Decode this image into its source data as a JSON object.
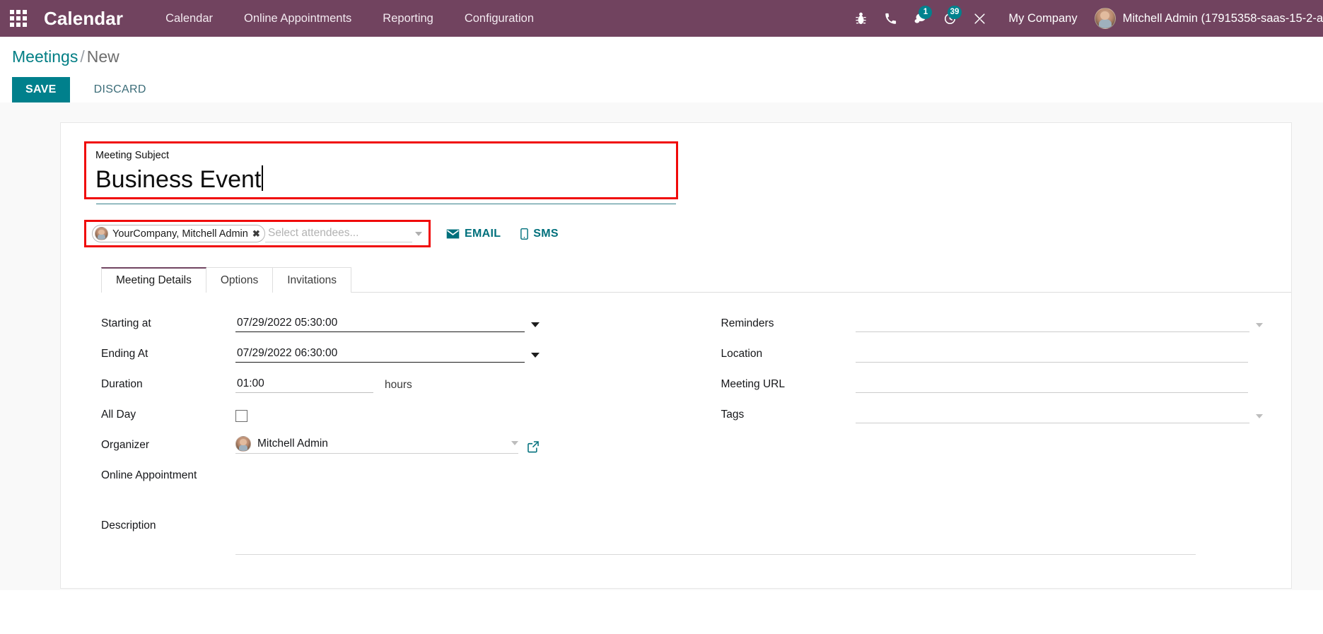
{
  "navbar": {
    "apps_icon": "apps-grid-icon",
    "brand": "Calendar",
    "menu": [
      {
        "label": "Calendar"
      },
      {
        "label": "Online Appointments"
      },
      {
        "label": "Reporting"
      },
      {
        "label": "Configuration"
      }
    ],
    "sys_icons": [
      {
        "name": "bug-icon",
        "badge": ""
      },
      {
        "name": "phone-icon",
        "badge": ""
      },
      {
        "name": "messages-icon",
        "badge": "1"
      },
      {
        "name": "activities-clock-icon",
        "badge": "39"
      },
      {
        "name": "tools-icon",
        "badge": ""
      }
    ],
    "company": "My Company",
    "user": "Mitchell Admin (17915358-saas-15-2-a",
    "bg_color": "#71435f",
    "badge_color": "#00828e"
  },
  "breadcrumb": {
    "root": "Meetings",
    "separator": "/",
    "current": "New"
  },
  "actions": {
    "save_label": "SAVE",
    "discard_label": "DISCARD",
    "save_color": "#00808c"
  },
  "form": {
    "subject": {
      "label": "Meeting Subject",
      "value": "Business Event",
      "highlight_color": "#f00a0a"
    },
    "attendees": {
      "tag": "YourCompany, Mitchell Admin",
      "tag_remove": "✖",
      "placeholder": "Select attendees...",
      "email_button": "EMAIL",
      "sms_button": "SMS"
    },
    "tabs": [
      {
        "label": "Meeting Details",
        "active": true
      },
      {
        "label": "Options",
        "active": false
      },
      {
        "label": "Invitations",
        "active": false
      }
    ],
    "left_fields": [
      {
        "label": "Starting at",
        "value": "07/29/2022 05:30:00"
      },
      {
        "label": "Ending At",
        "value": "07/29/2022 06:30:00"
      },
      {
        "label": "Duration",
        "value": "01:00",
        "units": "hours"
      },
      {
        "label": "All Day",
        "value": ""
      },
      {
        "label": "Organizer",
        "value": "Mitchell Admin"
      },
      {
        "label": "Online Appointment",
        "value": ""
      }
    ],
    "right_fields": [
      {
        "label": "Reminders",
        "value": ""
      },
      {
        "label": "Location",
        "value": ""
      },
      {
        "label": "Meeting URL",
        "value": ""
      },
      {
        "label": "Tags",
        "value": ""
      }
    ],
    "description": {
      "label": "Description",
      "value": ""
    }
  }
}
